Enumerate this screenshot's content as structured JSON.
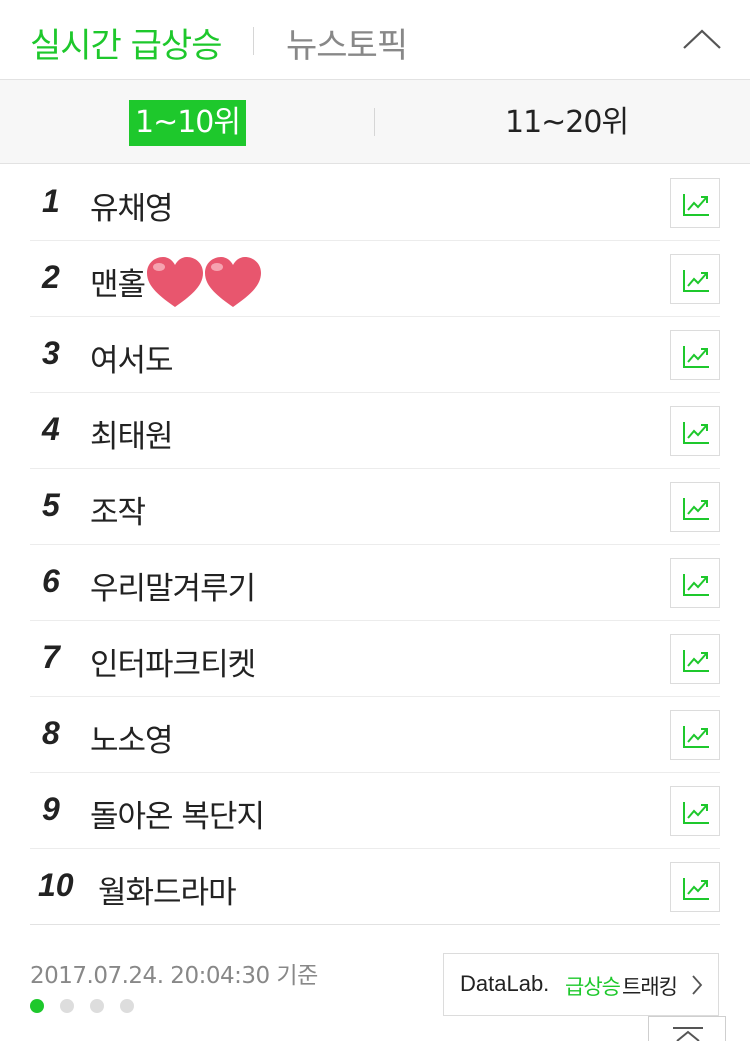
{
  "header": {
    "active_tab": "실시간 급상승",
    "other_tab": "뉴스토픽",
    "collapse_icon": "chevron-up-icon"
  },
  "subtabs": {
    "range1": "1~10위",
    "range2": "11~20위"
  },
  "ranks": [
    {
      "rank": "1",
      "keyword": "유채영"
    },
    {
      "rank": "2",
      "keyword": "맨홀"
    },
    {
      "rank": "3",
      "keyword": "여서도"
    },
    {
      "rank": "4",
      "keyword": "최태원"
    },
    {
      "rank": "5",
      "keyword": "조작"
    },
    {
      "rank": "6",
      "keyword": "우리말겨루기"
    },
    {
      "rank": "7",
      "keyword": "인터파크티켓"
    },
    {
      "rank": "8",
      "keyword": "노소영"
    },
    {
      "rank": "9",
      "keyword": "돌아온 복단지"
    },
    {
      "rank": "10",
      "keyword": "월화드라마"
    }
  ],
  "footer": {
    "timestamp": "2017.07.24. 20:04:30 기준",
    "datalab_brand": "DataLab.",
    "datalab_green": "급상승",
    "datalab_rest": "트래킹",
    "pagination_total": 4,
    "pagination_active": 1
  },
  "colors": {
    "accent": "#1ec82c",
    "heart": "#e8566e"
  }
}
